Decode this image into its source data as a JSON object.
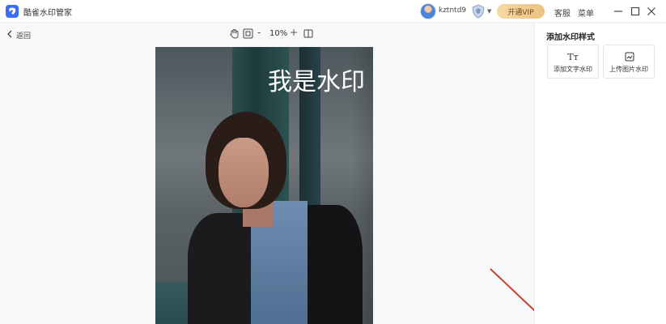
{
  "app": {
    "title": "酷雀水印管家"
  },
  "header": {
    "username": "kztntd9",
    "vip_label": "开通VIP",
    "service_label": "客服",
    "menu_label": "菜单"
  },
  "toolbar": {
    "back_label": "返回",
    "zoom_out_label": "-",
    "zoom_level": "10%",
    "zoom_in_label": "+"
  },
  "canvas": {
    "watermark_text": "我是水印"
  },
  "panel": {
    "title": "添加水印样式",
    "cards": [
      {
        "icon_text": "Tт",
        "label": "添加文字水印"
      },
      {
        "icon": "image-upload-icon",
        "label": "上传图片水印"
      }
    ]
  },
  "colors": {
    "brand": "#3b6cf6",
    "vip_gradient_start": "#f7d9a6",
    "vip_gradient_end": "#ebc280",
    "annotation_arrow": "#c8412e"
  }
}
